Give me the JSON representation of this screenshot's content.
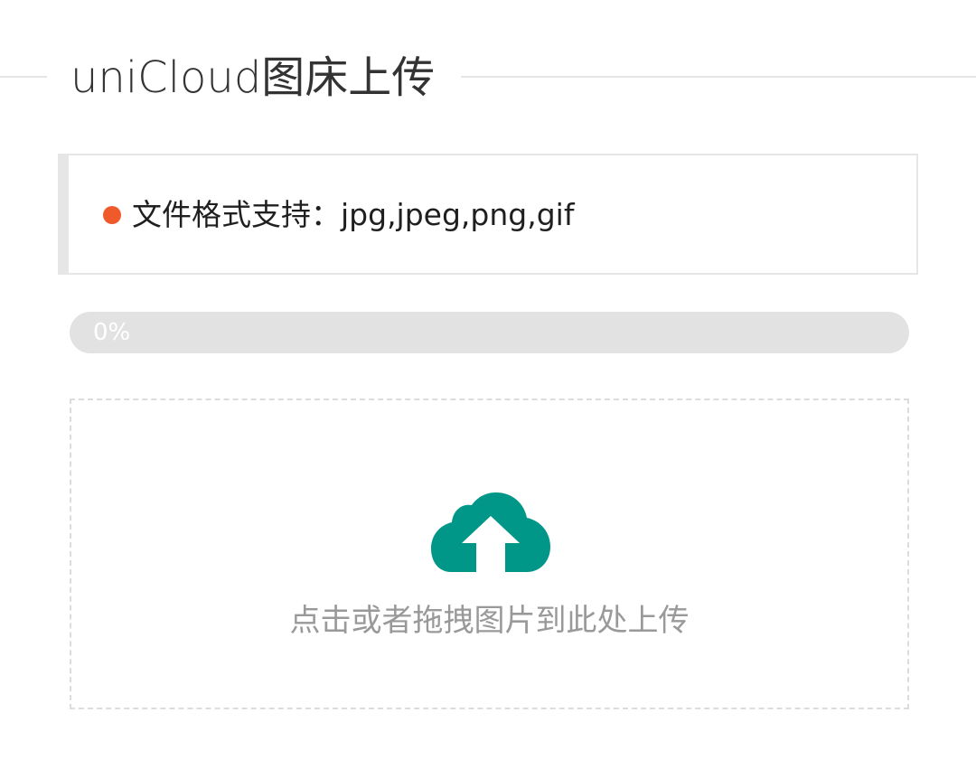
{
  "page": {
    "title": "uniCloud图床上传"
  },
  "notice": {
    "text": "文件格式支持：jpg,jpeg,png,gif",
    "dot_color": "#f05a2b"
  },
  "progress": {
    "label": "0%",
    "value": 0
  },
  "upload": {
    "icon": "cloud-upload-icon",
    "icon_color": "#009688",
    "hint": "点击或者拖拽图片到此处上传"
  }
}
